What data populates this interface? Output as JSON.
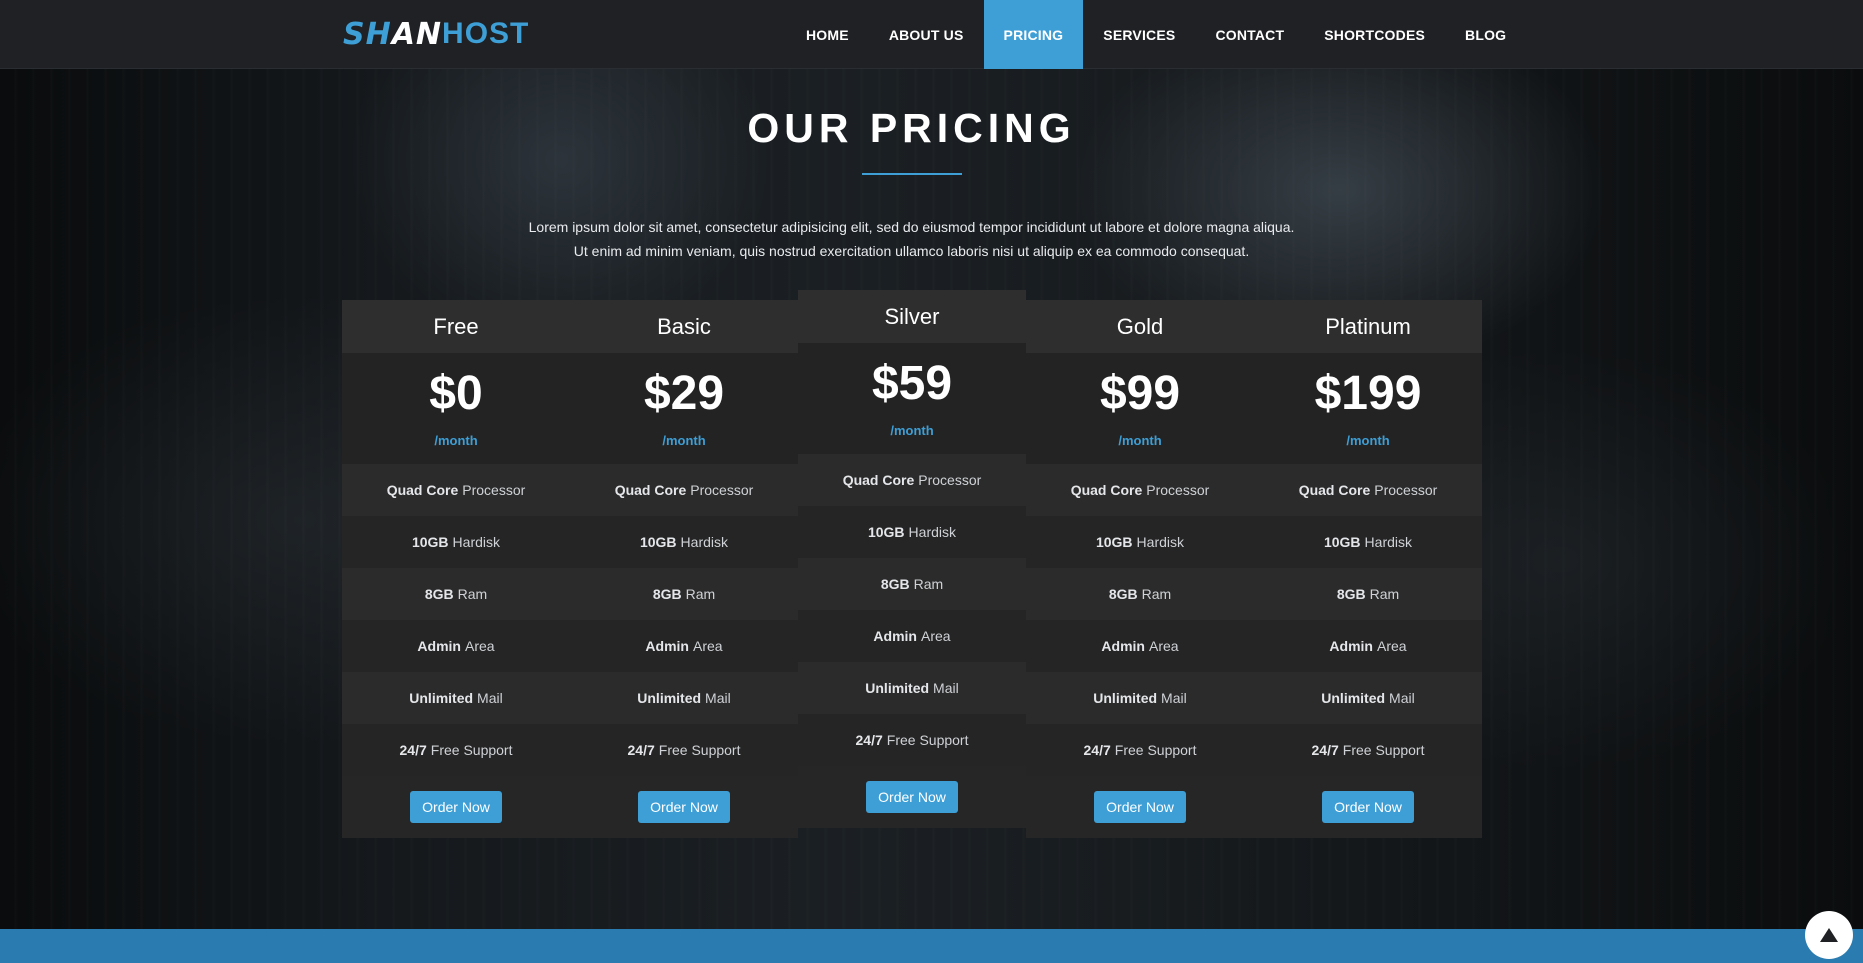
{
  "brand": {
    "part1": "SH",
    "part2": "AN",
    "part3": "HOST"
  },
  "nav": {
    "items": [
      {
        "label": "HOME"
      },
      {
        "label": "ABOUT US"
      },
      {
        "label": "PRICING",
        "active": true
      },
      {
        "label": "SERVICES"
      },
      {
        "label": "CONTACT"
      },
      {
        "label": "SHORTCODES"
      },
      {
        "label": "BLOG"
      }
    ]
  },
  "section": {
    "title": "OUR PRICING",
    "intro_line1": "Lorem ipsum dolor sit amet, consectetur adipisicing elit, sed do eiusmod tempor incididunt ut labore et dolore magna aliqua.",
    "intro_line2": "Ut enim ad minim veniam, quis nostrud exercitation ullamco laboris nisi ut aliquip ex ea commodo consequat."
  },
  "plans": [
    {
      "name": "Free",
      "price": "$0",
      "period": "/month"
    },
    {
      "name": "Basic",
      "price": "$29",
      "period": "/month"
    },
    {
      "name": "Silver",
      "price": "$59",
      "period": "/month",
      "featured": true
    },
    {
      "name": "Gold",
      "price": "$99",
      "period": "/month"
    },
    {
      "name": "Platinum",
      "price": "$199",
      "period": "/month"
    }
  ],
  "features": [
    {
      "strong": "Quad Core",
      "rest": "Processor"
    },
    {
      "strong": "10GB",
      "rest": "Hardisk"
    },
    {
      "strong": "8GB",
      "rest": "Ram"
    },
    {
      "strong": "Admin",
      "rest": "Area"
    },
    {
      "strong": "Unlimited",
      "rest": "Mail"
    },
    {
      "strong": "24/7",
      "rest": "Free Support"
    }
  ],
  "order_label": "Order Now",
  "colors": {
    "accent": "#3d9fd6",
    "navbar": "#1f2124",
    "footer": "#2a7bb0"
  },
  "icons": {
    "back_to_top": "triangle-up-icon"
  }
}
